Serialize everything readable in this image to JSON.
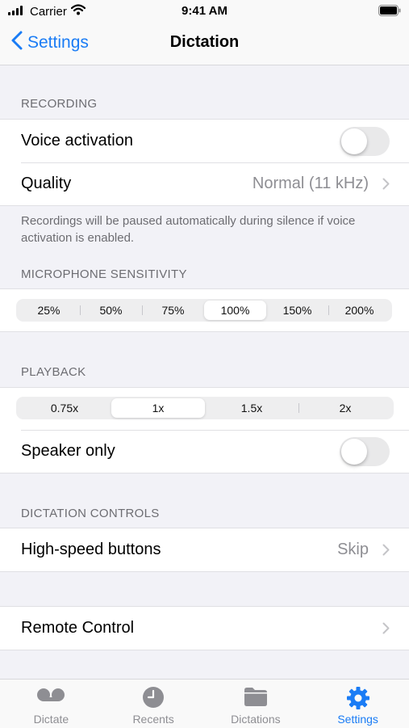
{
  "status_bar": {
    "carrier": "Carrier",
    "time": "9:41 AM"
  },
  "nav": {
    "back_label": "Settings",
    "title": "Dictation"
  },
  "recording": {
    "header": "RECORDING",
    "voice_activation_label": "Voice activation",
    "voice_activation_on": false,
    "quality_label": "Quality",
    "quality_value": "Normal (11 kHz)",
    "footer": "Recordings will be paused automatically during silence if voice activation is enabled."
  },
  "microphone": {
    "header": "MICROPHONE SENSITIVITY",
    "options": [
      "25%",
      "50%",
      "75%",
      "100%",
      "150%",
      "200%"
    ],
    "selected": "100%"
  },
  "playback": {
    "header": "PLAYBACK",
    "speeds": [
      "0.75x",
      "1x",
      "1.5x",
      "2x"
    ],
    "selected": "1x",
    "speaker_only_label": "Speaker only",
    "speaker_only_on": false
  },
  "dictation_controls": {
    "header": "DICTATION CONTROLS",
    "high_speed_label": "High-speed buttons",
    "high_speed_value": "Skip"
  },
  "remote": {
    "label": "Remote Control"
  },
  "tabs": [
    {
      "label": "Dictate",
      "icon": "voicemail-icon"
    },
    {
      "label": "Recents",
      "icon": "clock-icon"
    },
    {
      "label": "Dictations",
      "icon": "folder-icon"
    },
    {
      "label": "Settings",
      "icon": "gear-icon",
      "active": true
    }
  ],
  "colors": {
    "accent": "#1a7cf5",
    "background": "#f2f2f7",
    "secondary_text": "#8e8e93"
  }
}
